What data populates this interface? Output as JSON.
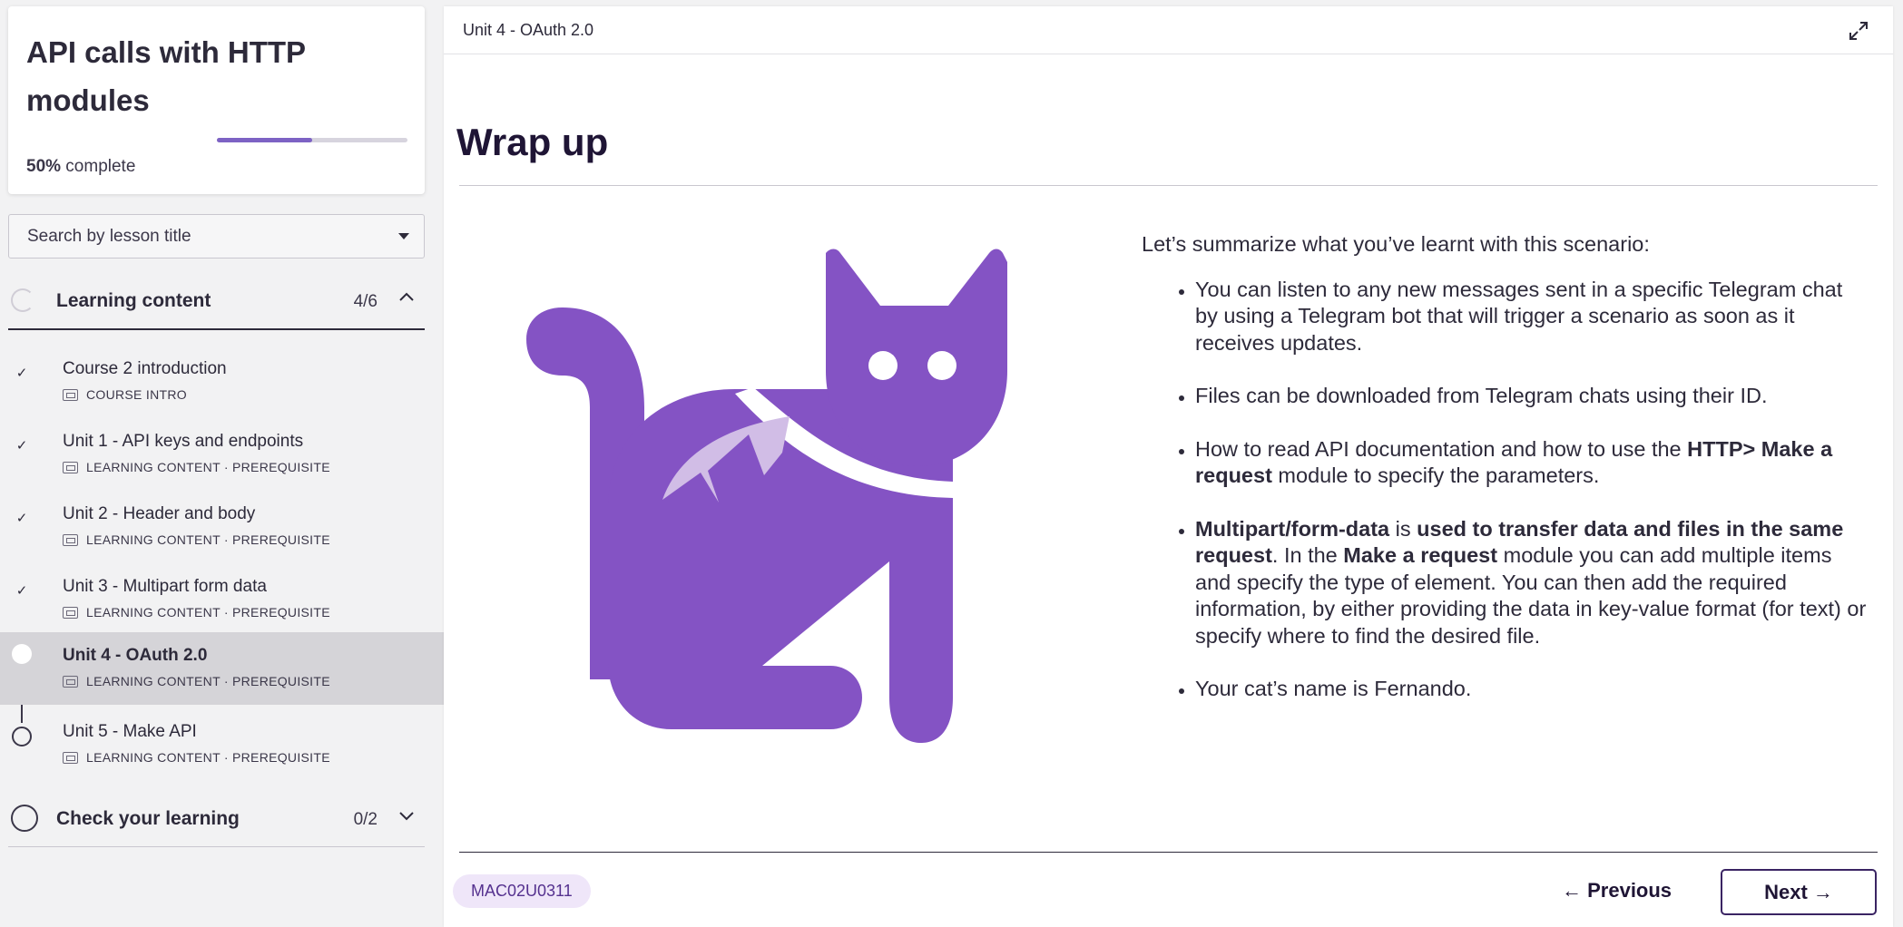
{
  "course": {
    "title": "API calls with HTTP modules",
    "progress_percent": 50,
    "progress_value": "50%",
    "progress_suffix": " complete"
  },
  "search": {
    "placeholder": "Search by lesson title"
  },
  "sections": {
    "learning": {
      "label": "Learning content",
      "count": "4/6",
      "lessons": [
        {
          "title": "Course 2 introduction",
          "meta": "COURSE INTRO",
          "status": "done"
        },
        {
          "title": "Unit 1 - API keys and endpoints",
          "meta": "LEARNING CONTENT · PREREQUISITE",
          "status": "done"
        },
        {
          "title": "Unit 2 - Header and body",
          "meta": "LEARNING CONTENT · PREREQUISITE",
          "status": "done"
        },
        {
          "title": "Unit 3 - Multipart form data",
          "meta": "LEARNING CONTENT · PREREQUISITE",
          "status": "done"
        },
        {
          "title": "Unit 4 - OAuth 2.0",
          "meta": "LEARNING CONTENT · PREREQUISITE",
          "status": "current"
        },
        {
          "title": "Unit 5 - Make API",
          "meta": "LEARNING CONTENT · PREREQUISITE",
          "status": "todo"
        }
      ]
    },
    "check": {
      "label": "Check your learning",
      "count": "0/2"
    }
  },
  "icons": {
    "done": "checkmark-icon",
    "expand": "expand-icon",
    "collapse": "chevron-up-icon",
    "dropdown": "chevron-down-icon"
  },
  "colors": {
    "accent": "#8453c4",
    "accent_light": "#d1bde6",
    "badge_bg": "#efe6f9",
    "text_dark": "#1f1535"
  },
  "main": {
    "unit_label": "Unit 4 - OAuth 2.0",
    "heading": "Wrap up",
    "intro": "Let’s summarize what you’ve learnt with this scenario:",
    "bullets": {
      "b1": "You can listen to any new messages sent in a specific Telegram chat by using a Telegram bot that will trigger a scenario as soon as it receives updates.",
      "b2": "Files can be downloaded from Telegram chats using their ID.",
      "b3_pre": "How to read API documentation and how to use the ",
      "b3_bold": "HTTP> Make a request",
      "b3_post": " module to specify the parameters.",
      "b4_bold1": "Multipart/form-data",
      "b4_mid1": " is ",
      "b4_bold2": "used to transfer data and files in the same request",
      "b4_mid2": ". In the ",
      "b4_bold3": "Make a request",
      "b4_post": " module you can add multiple items and specify the type of element. You can then add the required information, by either providing the data in key-value format (for text) or specify where to find the desired file.",
      "b5": "Your cat’s name is Fernando."
    },
    "code": "MAC02U0311",
    "prev_label": "← Previous",
    "next_label": "Next →"
  }
}
